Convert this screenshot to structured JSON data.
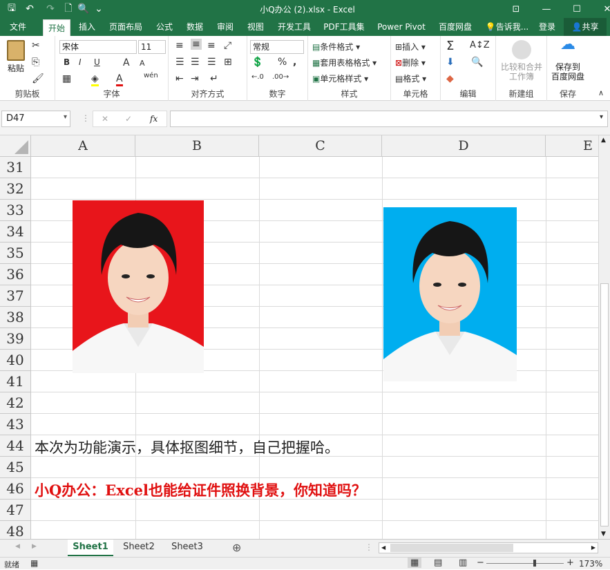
{
  "window": {
    "title": "小Q办公 (2).xlsx - Excel"
  },
  "qat": {
    "save": "🖫",
    "undo": "↶",
    "redo": "↷",
    "new": "🗋",
    "preview": "🔍",
    "more": "⌄"
  },
  "winctl": {
    "ribbon_opts": "⊡",
    "minimize": "—",
    "maximize": "☐",
    "close": "✕"
  },
  "tabs": [
    "文件",
    "开始",
    "插入",
    "页面布局",
    "公式",
    "数据",
    "审阅",
    "视图",
    "开发工具",
    "PDF工具集",
    "Power Pivot",
    "百度网盘"
  ],
  "tell_me": "告诉我...",
  "login": "登录",
  "share": "共享",
  "ribbon": {
    "clipboard": {
      "label": "剪贴板",
      "paste": "粘贴"
    },
    "font": {
      "label": "字体",
      "name": "宋体",
      "size": "11",
      "bold": "B",
      "italic": "I",
      "underline": "U",
      "grow": "A",
      "shrink": "A",
      "wen": "wén"
    },
    "align": {
      "label": "对齐方式"
    },
    "number": {
      "label": "数字",
      "format": "常规",
      "percent": "%",
      "comma": ","
    },
    "styles": {
      "label": "样式",
      "cond": "条件格式",
      "table": "套用表格格式",
      "cell": "单元格样式"
    },
    "cells": {
      "label": "单元格",
      "insert": "插入",
      "delete": "删除",
      "format": "格式"
    },
    "edit": {
      "label": "编辑"
    },
    "newgroup": {
      "label": "新建组",
      "compare1": "比较和合并",
      "compare2": "工作簿"
    },
    "save": {
      "label": "保存",
      "save1": "保存到",
      "save2": "百度网盘"
    }
  },
  "formula_bar": {
    "name_box": "D47",
    "cancel": "✕",
    "enter": "✓",
    "fx": "fx",
    "value": ""
  },
  "columns": [
    "A",
    "B",
    "C",
    "D",
    "E"
  ],
  "rows": [
    "31",
    "32",
    "33",
    "34",
    "35",
    "36",
    "37",
    "38",
    "39",
    "40",
    "41",
    "42",
    "43",
    "44",
    "45",
    "46",
    "47",
    "48"
  ],
  "cells": {
    "A44": "本次为功能演示，具体抠图细节，自己把握哈。",
    "A46": "小Q办公：Excel也能给证件照换背景，你知道吗？"
  },
  "colors": {
    "excel_green": "#217346",
    "red_bg": "#e8151b",
    "blue_bg": "#00aeef",
    "red_text": "#e01010"
  },
  "sheets": [
    "Sheet1",
    "Sheet2",
    "Sheet3"
  ],
  "status": {
    "ready": "就绪",
    "zoom": "173%",
    "minus": "−",
    "plus": "+"
  }
}
